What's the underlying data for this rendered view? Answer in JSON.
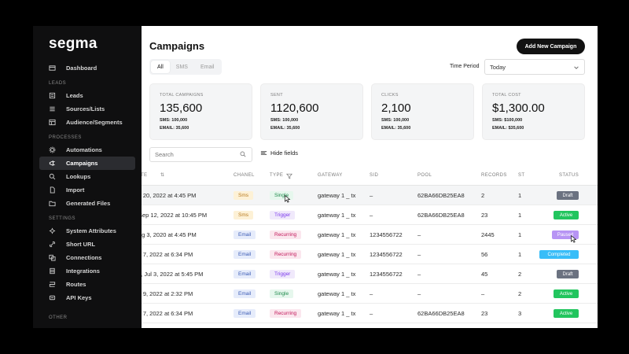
{
  "app": {
    "logo": "segma"
  },
  "sidebar": {
    "top_items": [
      {
        "label": "Dashboard",
        "icon": "dashboard-icon"
      }
    ],
    "sections": [
      {
        "title": "LEADS",
        "items": [
          {
            "label": "Leads",
            "icon": "leads-icon"
          },
          {
            "label": "Sources/Lists",
            "icon": "list-icon"
          },
          {
            "label": "Audience/Segments",
            "icon": "audience-icon"
          }
        ]
      },
      {
        "title": "PROCESSES",
        "items": [
          {
            "label": "Automations",
            "icon": "gear-icon"
          },
          {
            "label": "Campaigns",
            "icon": "megaphone-icon",
            "active": true
          },
          {
            "label": "Lookups",
            "icon": "search-icon"
          },
          {
            "label": "Import",
            "icon": "file-icon"
          },
          {
            "label": "Generated Files",
            "icon": "folder-icon"
          }
        ]
      },
      {
        "title": "SETTINGS",
        "items": [
          {
            "label": "System Attributes",
            "icon": "settings-icon"
          },
          {
            "label": "Short URL",
            "icon": "link-icon"
          },
          {
            "label": "Connections",
            "icon": "connections-icon"
          },
          {
            "label": "Integrations",
            "icon": "integrations-icon"
          },
          {
            "label": "Routes",
            "icon": "routes-icon"
          },
          {
            "label": "API Keys",
            "icon": "key-icon"
          }
        ]
      }
    ],
    "bottom_section": "OTHER"
  },
  "header": {
    "title": "Campaigns",
    "add_button": "Add New Campaign"
  },
  "filter_tabs": [
    {
      "label": "All",
      "active": true
    },
    {
      "label": "SMS"
    },
    {
      "label": "Email"
    }
  ],
  "time_period": {
    "label": "Time Period",
    "value": "Today"
  },
  "stats": [
    {
      "label": "TOTAL CAMPAIGNS",
      "value": "135,600",
      "sms": "SMS: 100,000",
      "email": "EMAIL: 35,600"
    },
    {
      "label": "SENT",
      "value": "1120,600",
      "sms": "SMS: 100,000",
      "email": "EMAIL: 35,600"
    },
    {
      "label": "CLICKS",
      "value": "2,100",
      "sms": "SMS: 100,000",
      "email": "EMAIL: 35,600"
    },
    {
      "label": "TOTAL COST",
      "value": "$1,300.00",
      "sms": "SMS: $100,000",
      "email": "EMAIL: $35,600"
    }
  ],
  "search": {
    "placeholder": "Search"
  },
  "hide_fields": "Hide fields",
  "table": {
    "columns": [
      "ATE",
      "CHANEL",
      "TYPE",
      "GATEWAY",
      "SID",
      "POOL",
      "RECORDS",
      "ST",
      "STATUS"
    ],
    "rows": [
      {
        "date": "v 20, 2022 at 4:45 PM",
        "channel": "Sms",
        "type": "Single",
        "gateway": "gateway 1 _ tx",
        "sid": "–",
        "pool": "62BA66DB25EA8",
        "records": "2",
        "st": "1",
        "status": "Draft"
      },
      {
        "date": "Sep 12, 2022 at 10:45 PM",
        "channel": "Sms",
        "type": "Trigger",
        "gateway": "gateway 1 _ tx",
        "sid": "–",
        "pool": "62BA66DB25EA8",
        "records": "23",
        "st": "1",
        "status": "Active"
      },
      {
        "date": "ug 3, 2020 at 4:45 PM",
        "channel": "Email",
        "type": "Recurring",
        "gateway": "gateway 1 _ tx",
        "sid": "1234556722",
        "pool": "–",
        "records": "2445",
        "st": "1",
        "status": "Paused"
      },
      {
        "date": "c 7, 2022 at 6:34 PM",
        "channel": "Email",
        "type": "Recurring",
        "gateway": "gateway 1 _ tx",
        "sid": "1234556722",
        "pool": "–",
        "records": "56",
        "st": "1",
        "status": "Completed"
      },
      {
        "date": "y, Jul 3, 2022 at 5:45 PM",
        "channel": "Email",
        "type": "Trigger",
        "gateway": "gateway 1 _ tx",
        "sid": "1234556722",
        "pool": "–",
        "records": "45",
        "st": "2",
        "status": "Draft"
      },
      {
        "date": "v 9, 2022 at 2:32 PM",
        "channel": "Email",
        "type": "Single",
        "gateway": "gateway 1 _ tx",
        "sid": "–",
        "pool": "–",
        "records": "–",
        "st": "2",
        "status": "Active"
      },
      {
        "date": "c 7, 2022 at 6:34 PM",
        "channel": "Email",
        "type": "Recurring",
        "gateway": "gateway 1 _ tx",
        "sid": "–",
        "pool": "62BA66DB25EA8",
        "records": "23",
        "st": "3",
        "status": "Active"
      }
    ]
  },
  "colors": {
    "sidebar_bg": "#0f0f10",
    "status_draft": "#6b7280",
    "status_active": "#22c55e",
    "status_paused": "#b794f4",
    "status_completed": "#38bdf8",
    "sms_pill_bg": "#fdf1d6",
    "sms_pill_fg": "#b7791f",
    "email_pill_bg": "#e6ecfb",
    "email_pill_fg": "#3b5bb5",
    "single_bg": "#e6f7ed",
    "single_fg": "#1f8a4c",
    "trigger_bg": "#f0e9fb",
    "trigger_fg": "#7c3aed",
    "recurring_bg": "#fbe7ee",
    "recurring_fg": "#c2185b"
  }
}
